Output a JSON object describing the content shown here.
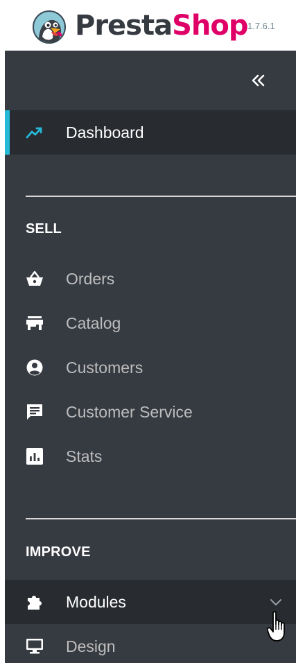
{
  "header": {
    "brand_part1": "Presta",
    "brand_part2": "Shop",
    "version": "1.7.6.1",
    "logo_icon": "prestashop-puffin-logo",
    "brand_colors": {
      "dark": "#363a41",
      "pink": "#df0067"
    }
  },
  "sidebar": {
    "collapse_icon": "double-chevron-left-icon",
    "colors": {
      "background": "#363a41",
      "active_background": "#282b30",
      "accent": "#25b9d7"
    },
    "dashboard": {
      "label": "Dashboard",
      "icon": "trending-up-icon"
    },
    "sections": [
      {
        "title": "SELL",
        "items": [
          {
            "label": "Orders",
            "icon": "basket-icon"
          },
          {
            "label": "Catalog",
            "icon": "store-icon"
          },
          {
            "label": "Customers",
            "icon": "account-circle-icon"
          },
          {
            "label": "Customer Service",
            "icon": "chat-icon"
          },
          {
            "label": "Stats",
            "icon": "bar-chart-icon"
          }
        ]
      },
      {
        "title": "IMPROVE",
        "items": [
          {
            "label": "Modules",
            "icon": "puzzle-icon",
            "active": true,
            "expand_icon": "chevron-down-icon"
          },
          {
            "label": "Design",
            "icon": "monitor-icon"
          }
        ]
      }
    ]
  }
}
